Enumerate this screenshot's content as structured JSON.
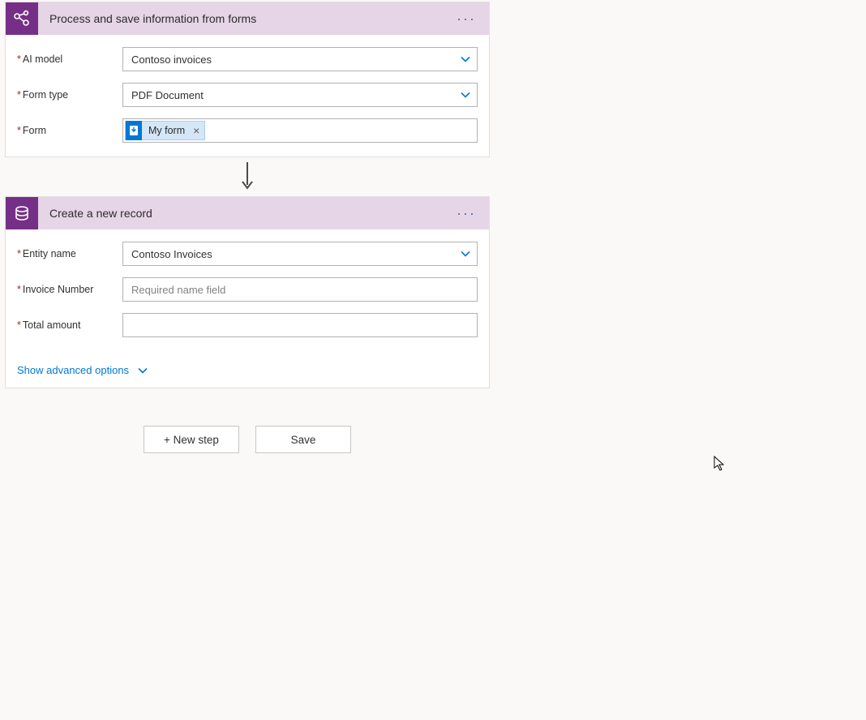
{
  "step1": {
    "title": "Process and save information from forms",
    "fields": {
      "ai_model": {
        "label": "AI model",
        "value": "Contoso invoices"
      },
      "form_type": {
        "label": "Form type",
        "value": "PDF Document"
      },
      "form": {
        "label": "Form",
        "token": "My form"
      }
    }
  },
  "step2": {
    "title": "Create a new record",
    "fields": {
      "entity_name": {
        "label": "Entity name",
        "value": "Contoso Invoices"
      },
      "invoice_number": {
        "label": "Invoice Number",
        "placeholder": "Required name field",
        "value": ""
      },
      "total_amount": {
        "label": "Total amount",
        "value": ""
      }
    },
    "show_advanced": "Show advanced options"
  },
  "buttons": {
    "new_step": "+ New step",
    "save": "Save"
  }
}
